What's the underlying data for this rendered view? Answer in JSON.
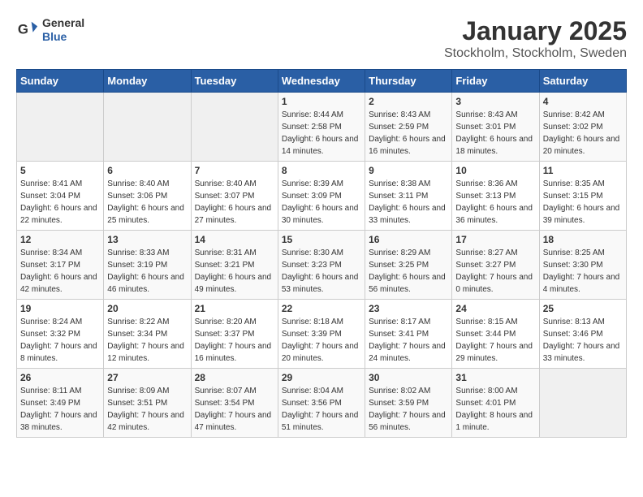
{
  "logo": {
    "line1": "General",
    "line2": "Blue"
  },
  "title": "January 2025",
  "subtitle": "Stockholm, Stockholm, Sweden",
  "headers": [
    "Sunday",
    "Monday",
    "Tuesday",
    "Wednesday",
    "Thursday",
    "Friday",
    "Saturday"
  ],
  "weeks": [
    [
      {
        "day": "",
        "sunrise": "",
        "sunset": "",
        "daylight": ""
      },
      {
        "day": "",
        "sunrise": "",
        "sunset": "",
        "daylight": ""
      },
      {
        "day": "",
        "sunrise": "",
        "sunset": "",
        "daylight": ""
      },
      {
        "day": "1",
        "sunrise": "Sunrise: 8:44 AM",
        "sunset": "Sunset: 2:58 PM",
        "daylight": "Daylight: 6 hours and 14 minutes."
      },
      {
        "day": "2",
        "sunrise": "Sunrise: 8:43 AM",
        "sunset": "Sunset: 2:59 PM",
        "daylight": "Daylight: 6 hours and 16 minutes."
      },
      {
        "day": "3",
        "sunrise": "Sunrise: 8:43 AM",
        "sunset": "Sunset: 3:01 PM",
        "daylight": "Daylight: 6 hours and 18 minutes."
      },
      {
        "day": "4",
        "sunrise": "Sunrise: 8:42 AM",
        "sunset": "Sunset: 3:02 PM",
        "daylight": "Daylight: 6 hours and 20 minutes."
      }
    ],
    [
      {
        "day": "5",
        "sunrise": "Sunrise: 8:41 AM",
        "sunset": "Sunset: 3:04 PM",
        "daylight": "Daylight: 6 hours and 22 minutes."
      },
      {
        "day": "6",
        "sunrise": "Sunrise: 8:40 AM",
        "sunset": "Sunset: 3:06 PM",
        "daylight": "Daylight: 6 hours and 25 minutes."
      },
      {
        "day": "7",
        "sunrise": "Sunrise: 8:40 AM",
        "sunset": "Sunset: 3:07 PM",
        "daylight": "Daylight: 6 hours and 27 minutes."
      },
      {
        "day": "8",
        "sunrise": "Sunrise: 8:39 AM",
        "sunset": "Sunset: 3:09 PM",
        "daylight": "Daylight: 6 hours and 30 minutes."
      },
      {
        "day": "9",
        "sunrise": "Sunrise: 8:38 AM",
        "sunset": "Sunset: 3:11 PM",
        "daylight": "Daylight: 6 hours and 33 minutes."
      },
      {
        "day": "10",
        "sunrise": "Sunrise: 8:36 AM",
        "sunset": "Sunset: 3:13 PM",
        "daylight": "Daylight: 6 hours and 36 minutes."
      },
      {
        "day": "11",
        "sunrise": "Sunrise: 8:35 AM",
        "sunset": "Sunset: 3:15 PM",
        "daylight": "Daylight: 6 hours and 39 minutes."
      }
    ],
    [
      {
        "day": "12",
        "sunrise": "Sunrise: 8:34 AM",
        "sunset": "Sunset: 3:17 PM",
        "daylight": "Daylight: 6 hours and 42 minutes."
      },
      {
        "day": "13",
        "sunrise": "Sunrise: 8:33 AM",
        "sunset": "Sunset: 3:19 PM",
        "daylight": "Daylight: 6 hours and 46 minutes."
      },
      {
        "day": "14",
        "sunrise": "Sunrise: 8:31 AM",
        "sunset": "Sunset: 3:21 PM",
        "daylight": "Daylight: 6 hours and 49 minutes."
      },
      {
        "day": "15",
        "sunrise": "Sunrise: 8:30 AM",
        "sunset": "Sunset: 3:23 PM",
        "daylight": "Daylight: 6 hours and 53 minutes."
      },
      {
        "day": "16",
        "sunrise": "Sunrise: 8:29 AM",
        "sunset": "Sunset: 3:25 PM",
        "daylight": "Daylight: 6 hours and 56 minutes."
      },
      {
        "day": "17",
        "sunrise": "Sunrise: 8:27 AM",
        "sunset": "Sunset: 3:27 PM",
        "daylight": "Daylight: 7 hours and 0 minutes."
      },
      {
        "day": "18",
        "sunrise": "Sunrise: 8:25 AM",
        "sunset": "Sunset: 3:30 PM",
        "daylight": "Daylight: 7 hours and 4 minutes."
      }
    ],
    [
      {
        "day": "19",
        "sunrise": "Sunrise: 8:24 AM",
        "sunset": "Sunset: 3:32 PM",
        "daylight": "Daylight: 7 hours and 8 minutes."
      },
      {
        "day": "20",
        "sunrise": "Sunrise: 8:22 AM",
        "sunset": "Sunset: 3:34 PM",
        "daylight": "Daylight: 7 hours and 12 minutes."
      },
      {
        "day": "21",
        "sunrise": "Sunrise: 8:20 AM",
        "sunset": "Sunset: 3:37 PM",
        "daylight": "Daylight: 7 hours and 16 minutes."
      },
      {
        "day": "22",
        "sunrise": "Sunrise: 8:18 AM",
        "sunset": "Sunset: 3:39 PM",
        "daylight": "Daylight: 7 hours and 20 minutes."
      },
      {
        "day": "23",
        "sunrise": "Sunrise: 8:17 AM",
        "sunset": "Sunset: 3:41 PM",
        "daylight": "Daylight: 7 hours and 24 minutes."
      },
      {
        "day": "24",
        "sunrise": "Sunrise: 8:15 AM",
        "sunset": "Sunset: 3:44 PM",
        "daylight": "Daylight: 7 hours and 29 minutes."
      },
      {
        "day": "25",
        "sunrise": "Sunrise: 8:13 AM",
        "sunset": "Sunset: 3:46 PM",
        "daylight": "Daylight: 7 hours and 33 minutes."
      }
    ],
    [
      {
        "day": "26",
        "sunrise": "Sunrise: 8:11 AM",
        "sunset": "Sunset: 3:49 PM",
        "daylight": "Daylight: 7 hours and 38 minutes."
      },
      {
        "day": "27",
        "sunrise": "Sunrise: 8:09 AM",
        "sunset": "Sunset: 3:51 PM",
        "daylight": "Daylight: 7 hours and 42 minutes."
      },
      {
        "day": "28",
        "sunrise": "Sunrise: 8:07 AM",
        "sunset": "Sunset: 3:54 PM",
        "daylight": "Daylight: 7 hours and 47 minutes."
      },
      {
        "day": "29",
        "sunrise": "Sunrise: 8:04 AM",
        "sunset": "Sunset: 3:56 PM",
        "daylight": "Daylight: 7 hours and 51 minutes."
      },
      {
        "day": "30",
        "sunrise": "Sunrise: 8:02 AM",
        "sunset": "Sunset: 3:59 PM",
        "daylight": "Daylight: 7 hours and 56 minutes."
      },
      {
        "day": "31",
        "sunrise": "Sunrise: 8:00 AM",
        "sunset": "Sunset: 4:01 PM",
        "daylight": "Daylight: 8 hours and 1 minute."
      },
      {
        "day": "",
        "sunrise": "",
        "sunset": "",
        "daylight": ""
      }
    ]
  ]
}
